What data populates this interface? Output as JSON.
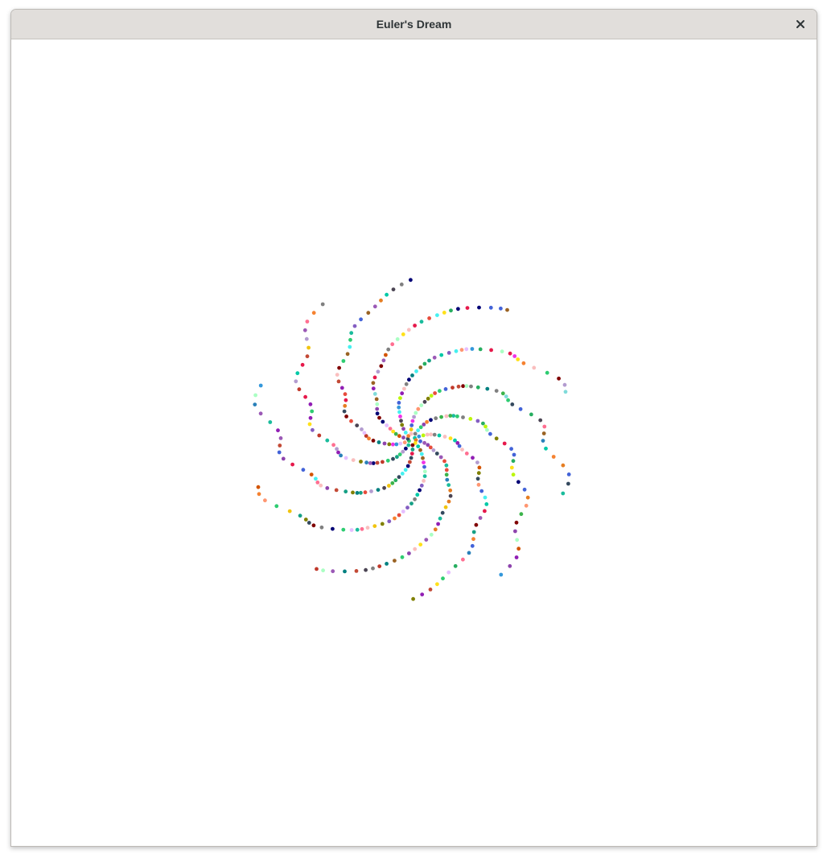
{
  "window": {
    "title": "Euler's Dream"
  },
  "titlebar": {
    "close_icon": "close-icon"
  },
  "canvas": {
    "background": "#ffffff",
    "description_kind": "scatter",
    "dot_count": 380,
    "dot_colors": [
      "#e6194b",
      "#3cb44b",
      "#ffe119",
      "#4363d8",
      "#f58231",
      "#911eb4",
      "#46f0f0",
      "#f032e6",
      "#bcf60c",
      "#fabebe",
      "#008080",
      "#e6beff",
      "#9a6324",
      "#aaffc3",
      "#800000",
      "#808000",
      "#000075",
      "#808080",
      "#1abc9c",
      "#2ecc71",
      "#3498db",
      "#9b59b6",
      "#34495e",
      "#16a085",
      "#27ae60",
      "#2980b9",
      "#8e44ad",
      "#f1c40f",
      "#e67e22",
      "#e74c3c",
      "#c0392b",
      "#d35400",
      "#7fdbda",
      "#ff6f91",
      "#845ec2",
      "#00c9a7",
      "#c34a36",
      "#4b4453",
      "#b39cd0",
      "#ff9671"
    ]
  }
}
